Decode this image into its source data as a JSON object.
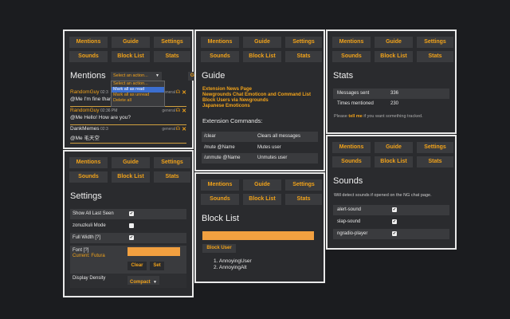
{
  "tabs": {
    "mentions": "Mentions",
    "guide": "Guide",
    "settings": "Settings",
    "sounds": "Sounds",
    "blocklist": "Block List",
    "stats": "Stats"
  },
  "mentions": {
    "title": "Mentions",
    "select_value": "Select an action...",
    "go_label": "Go",
    "dropdown": [
      "Select an action...",
      "Mark all as read",
      "Mark all as unread",
      "Delete all"
    ],
    "items": [
      {
        "user": "RandomGuy",
        "time": "02:3",
        "channel": "general",
        "msg": "@Me I'm fine than"
      },
      {
        "user": "RandomGuy",
        "time": "02:36 PM",
        "channel": "general",
        "msg": "@Me Hello! How are you?"
      },
      {
        "user": "DankMemes",
        "time": "02:3",
        "channel": "general",
        "msg": "@Me 毛天空"
      }
    ]
  },
  "guide": {
    "title": "Guide",
    "links": [
      "Extension News Page",
      "Newgrounds Chat Emoticon and Command List",
      "Block Users via Newgrounds",
      "Japanese Emoticons"
    ],
    "commands_title": "Extension Commands:",
    "commands": [
      {
        "cmd": "/clear",
        "desc": "Clears all messages"
      },
      {
        "cmd": "/mute @Name",
        "desc": "Mutes user"
      },
      {
        "cmd": "/unmute @Name",
        "desc": "Unmutes user"
      }
    ]
  },
  "stats": {
    "title": "Stats",
    "rows": [
      {
        "label": "Messages sent",
        "value": "336"
      },
      {
        "label": "Times mentioned",
        "value": "230"
      }
    ],
    "note_pre": "Please ",
    "note_link": "tell me",
    "note_post": " if you want something tracked."
  },
  "settings": {
    "title": "Settings",
    "rows": [
      {
        "label": "Show All Last Seen",
        "checked": true
      },
      {
        "label": "zonuzkuli Mode",
        "checked": false
      },
      {
        "label": "Full Width [?]",
        "checked": true
      }
    ],
    "font_label": "Font [?]",
    "font_current": "Current: Futura",
    "clear_label": "Clear",
    "set_label": "Set",
    "density_label": "Display Density",
    "density_value": "Compact"
  },
  "blocklist": {
    "title": "Block List",
    "block_button": "Block User",
    "users": [
      "1. AnnoyingUser",
      "2. AnnoyingAlt"
    ]
  },
  "sounds": {
    "title": "Sounds",
    "desc": "Will detect sounds if opened on the NG chat page.",
    "items": [
      {
        "name": "alert-sound",
        "checked": true
      },
      {
        "name": "slap-sound",
        "checked": true
      },
      {
        "name": "ngradio-player",
        "checked": true
      }
    ]
  },
  "colors": {
    "accent": "#f2a31a",
    "panel": "#2a2b2e",
    "row": "#3a3b3e",
    "bg": "#1b1c1f"
  }
}
